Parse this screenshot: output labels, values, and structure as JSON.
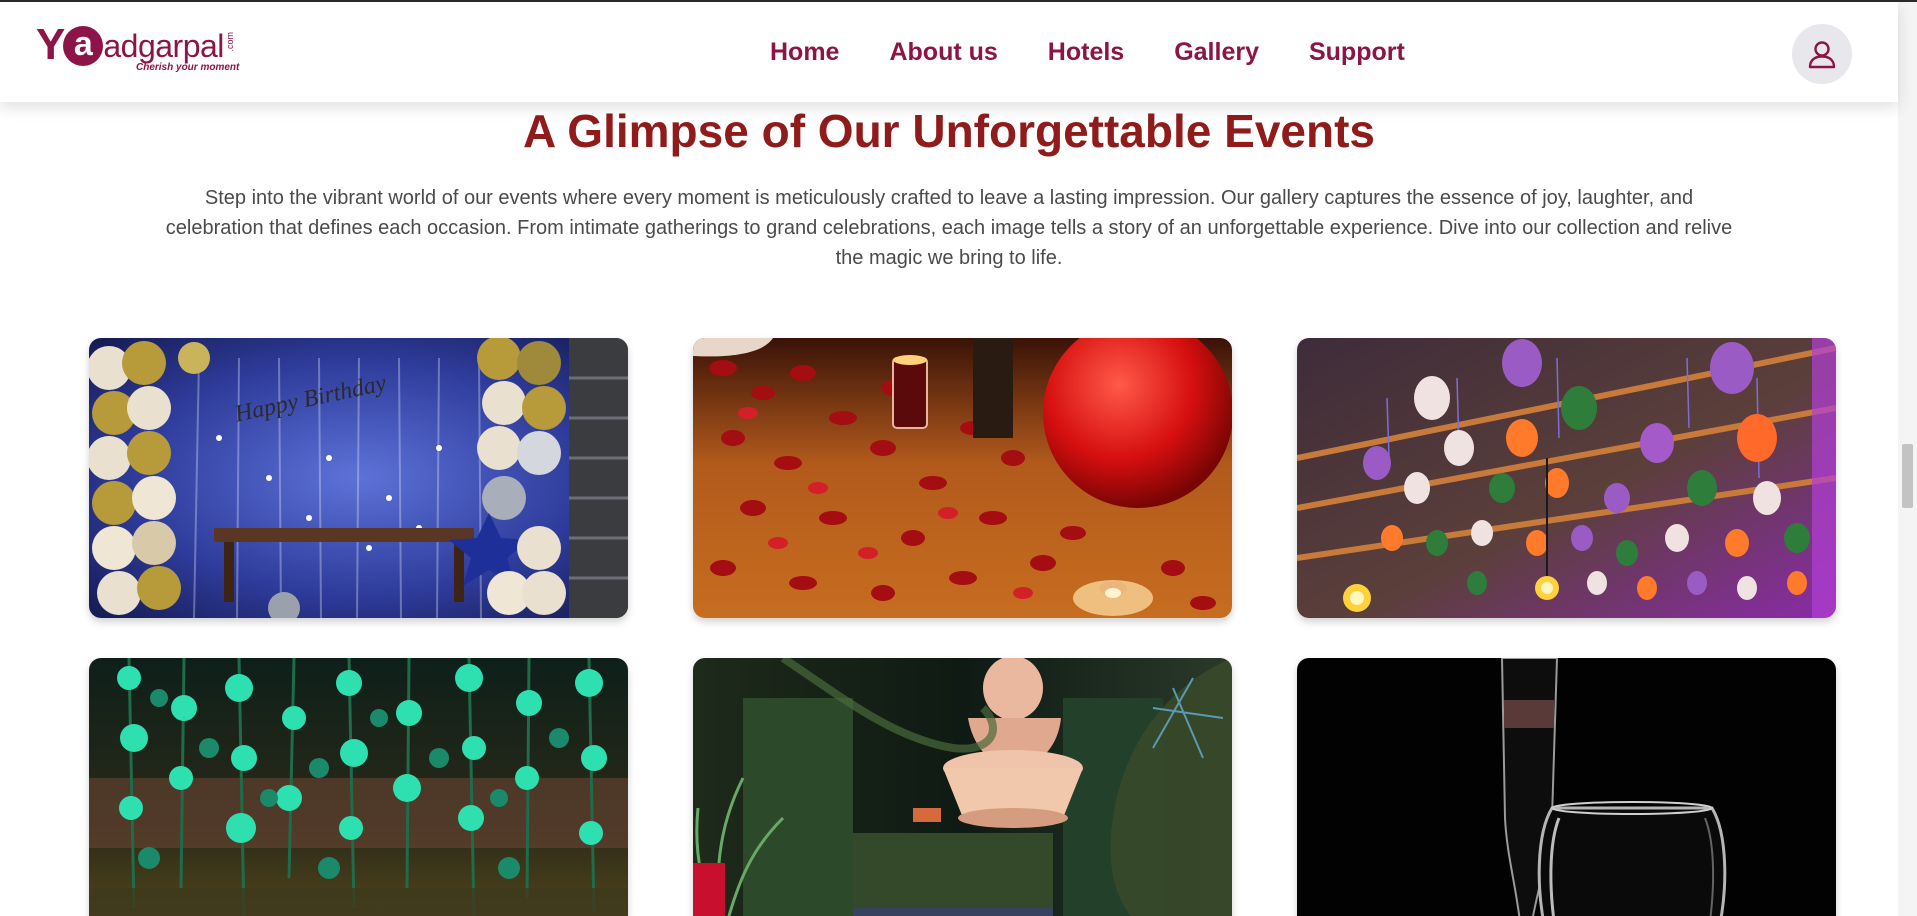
{
  "brand": {
    "logo_y": "Y",
    "logo_a": "a",
    "logo_rest": "adgarpal",
    "logo_com": ".com",
    "tagline": "Cherish your moment"
  },
  "nav": {
    "items": [
      "Home",
      "About us",
      "Hotels",
      "Gallery",
      "Support"
    ]
  },
  "section": {
    "title": "A Glimpse of Our Unforgettable Events",
    "intro": "Step into the vibrant world of our events where every moment is meticulously crafted to leave a lasting impression. Our gallery captures the essence of joy, laughter, and celebration that defines each occasion. From intimate gatherings to grand celebrations, each image tells a story of an unforgettable experience. Dive into our collection and relive the magic we bring to life."
  },
  "gallery": {
    "photos": [
      {
        "subject": "birthday balloon decoration",
        "banner_text": "Happy Birthday"
      },
      {
        "subject": "rose petals and red balloon"
      },
      {
        "subject": "colorful balloons on ceiling"
      },
      {
        "subject": "green floral hanging decor"
      },
      {
        "subject": "buddha statue with plants"
      },
      {
        "subject": "champagne glasses on black"
      }
    ]
  },
  "colors": {
    "brand": "#8c1446",
    "heading": "#8f1b1b",
    "body_text": "#4a4a4a"
  }
}
